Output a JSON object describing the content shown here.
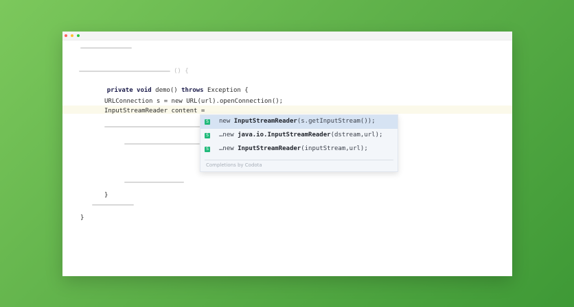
{
  "editor": {
    "line_method": {
      "kw_private": "private",
      "kw_void": "void",
      "name": "demo()",
      "kw_throws": "throws",
      "rest": "Exception {"
    },
    "ghost_paren": "() {",
    "line_conn": "URLConnection s = new URL(url).openConnection();",
    "line_reader": "InputStreamReader content =",
    "brace_inner": "}",
    "brace_outer": "}"
  },
  "completions": {
    "items": [
      {
        "prefix": "new ",
        "cls": "InputStreamReader",
        "args": "(s.getInputStream());"
      },
      {
        "prefix": "…new ",
        "cls": "java.io.InputStreamReader",
        "args": "(dstream,url);"
      },
      {
        "prefix": "…new ",
        "cls": "InputStreamReader",
        "args": "(inputStream,url);"
      }
    ],
    "footer": "Completions by Codota",
    "icon_symbol": "S"
  },
  "colors": {
    "selected": "#d6e3f3",
    "icon": "#1fb97a",
    "background_accent": "#5fb14a"
  },
  "icons": [
    "codota-icon"
  ]
}
